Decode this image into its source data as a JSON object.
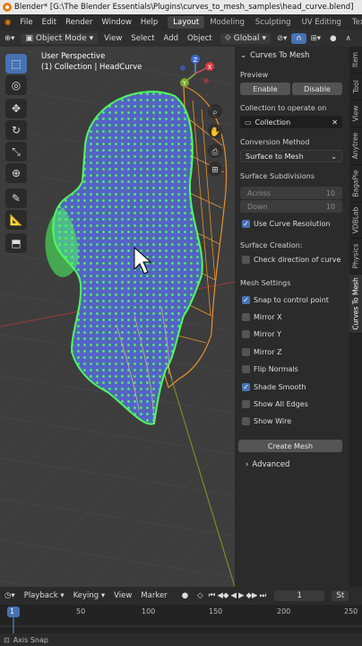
{
  "window": {
    "title": "Blender* [G:\\The Blender Essentials\\Plugins\\curves_to_mesh_samples\\head_curve.blend]"
  },
  "menu": {
    "items": [
      "File",
      "Edit",
      "Render",
      "Window",
      "Help"
    ],
    "workspaces": [
      "Layout",
      "Modeling",
      "Sculpting",
      "UV Editing",
      "Texture Paint"
    ],
    "active_workspace": "Layout"
  },
  "header": {
    "mode": "Object Mode",
    "view": "View",
    "select": "Select",
    "add": "Add",
    "object": "Object",
    "orientation": "Global"
  },
  "viewport": {
    "perspective": "User Perspective",
    "collection_path": "(1) Collection | HeadCurve",
    "gizmo": {
      "x": "X",
      "y": "Y",
      "z": "Z"
    }
  },
  "panel": {
    "title": "Curves To Mesh",
    "preview_label": "Preview",
    "enable": "Enable",
    "disable": "Disable",
    "collection_label": "Collection to operate on",
    "collection_value": "Collection",
    "conversion_label": "Conversion Method",
    "conversion_value": "Surface to Mesh",
    "subdiv_label": "Surface Subdivisions",
    "across_label": "Across",
    "across_value": "10",
    "down_label": "Down",
    "down_value": "10",
    "use_curve_res": "Use Curve Resolution",
    "surface_creation": "Surface Creation:",
    "check_direction": "Check direction of curve",
    "mesh_settings": "Mesh Settings",
    "snap": "Snap to control point",
    "mirror_x": "Mirror X",
    "mirror_y": "Mirror Y",
    "mirror_z": "Mirror Z",
    "flip_normals": "Flip Normals",
    "shade_smooth": "Shade Smooth",
    "show_all_edges": "Show All Edges",
    "show_wire": "Show Wire",
    "create_mesh": "Create Mesh",
    "advanced": "Advanced"
  },
  "checks": {
    "use_curve_res": true,
    "check_direction": false,
    "snap": true,
    "mirror_x": false,
    "mirror_y": false,
    "mirror_z": false,
    "flip_normals": false,
    "shade_smooth": true,
    "show_all_edges": false,
    "show_wire": false
  },
  "side_tabs": [
    "Item",
    "Tool",
    "View",
    "Anytree",
    "BagaPie",
    "VDBLab",
    "Physics",
    "Curves To Mesh"
  ],
  "timeline": {
    "playback": "Playback",
    "keying": "Keying",
    "view": "View",
    "marker": "Marker",
    "current_frame": "1",
    "st": "St"
  },
  "ruler": {
    "ticks": [
      "1",
      "50",
      "100",
      "150",
      "200",
      "250"
    ],
    "current": "1"
  },
  "status": {
    "text": "Axis Snap"
  },
  "colors": {
    "accent": "#4772b3",
    "wire_green": "#4cff5e",
    "mesh_blue": "#5562c9",
    "curve_orange": "#e8922a"
  }
}
